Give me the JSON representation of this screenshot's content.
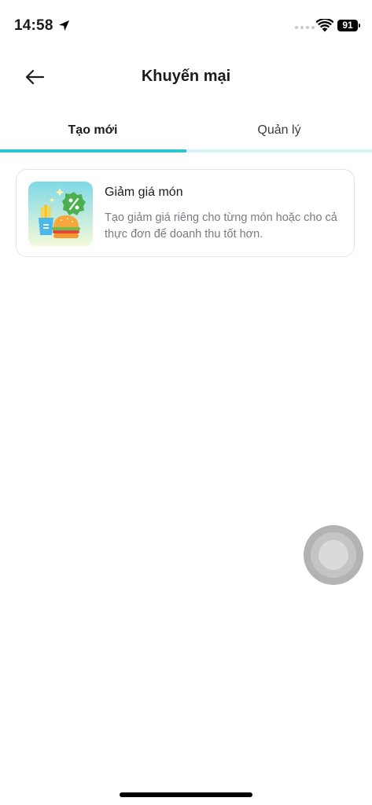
{
  "status_bar": {
    "time": "14:58",
    "battery": "91",
    "location_icon": "location-arrow-icon",
    "wifi_icon": "wifi-icon"
  },
  "header": {
    "title": "Khuyến mại",
    "back_icon": "arrow-left-icon"
  },
  "tabs": [
    {
      "label": "Tạo mới",
      "active": true
    },
    {
      "label": "Quản lý",
      "active": false
    }
  ],
  "colors": {
    "accent": "#2ec4cf",
    "accent_light": "#d6f2f4",
    "card_border": "#e3e4e6",
    "muted_text": "#7a7b80"
  },
  "promo_cards": [
    {
      "title": "Giảm giá món",
      "description": "Tạo giảm giá riêng cho từng món hoặc cho cả thực đơn để doanh thu tốt hơn.",
      "icon": "food-discount-icon"
    }
  ]
}
